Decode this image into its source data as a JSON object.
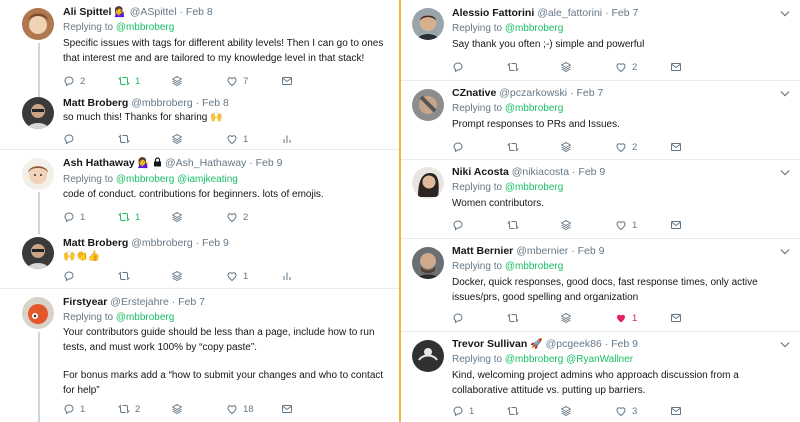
{
  "left": [
    {
      "name": "Ali Spittel",
      "handle": "@ASpittel",
      "time": "Feb 8",
      "emoji": "💁‍♀️",
      "reply_prefix": "Replying to",
      "reply_to": "@mbbroberg",
      "text": "Specific issues with tags for different ability levels! Then I can go to ones that interest me and are tailored to my knowledge level in that stack!",
      "replies": "2",
      "retweets": "1",
      "likes": "7"
    },
    {
      "name": "Matt Broberg",
      "handle": "@mbbroberg",
      "time": "Feb 8",
      "text": "so much this! Thanks for sharing 🙌",
      "likes": "1"
    },
    {
      "name": "Ash Hathaway",
      "handle": "@Ash_Hathaway",
      "time": "Feb 9",
      "emoji": "💁‍♀️",
      "reply_prefix": "Replying to",
      "reply_to": "@mbbroberg",
      "reply_to2": "@iamjkeating",
      "text": "code of conduct. contributions for beginners. lots of emojis.",
      "replies": "1",
      "retweets": "1",
      "likes": "2"
    },
    {
      "name": "Matt Broberg",
      "handle": "@mbbroberg",
      "time": "Feb 9",
      "text": "🙌👏👍",
      "likes": "1"
    },
    {
      "name": "Firstyear",
      "handle": "@Erstejahre",
      "time": "Feb 7",
      "reply_prefix": "Replying to",
      "reply_to": "@mbbroberg",
      "text1": "Your contributors guide should be less than a page, include how to run tests, and must work 100% by “copy paste”.",
      "text2": "For bonus marks add a “how to submit your changes and who to contact for help”",
      "replies": "1",
      "retweets": "2",
      "likes": "18"
    }
  ],
  "right": [
    {
      "name": "Alessio Fattorini",
      "handle": "@ale_fattorini",
      "time": "Feb 7",
      "reply_prefix": "Replying to",
      "reply_to": "@mbbroberg",
      "text": "Say thank you often ;-) simple and powerful",
      "likes": "2"
    },
    {
      "name": "CZnative",
      "handle": "@pczarkowski",
      "time": "Feb 7",
      "reply_prefix": "Replying to",
      "reply_to": "@mbbroberg",
      "text": "Prompt responses to PRs and Issues.",
      "likes": "2"
    },
    {
      "name": "Niki Acosta",
      "handle": "@nikiacosta",
      "time": "Feb 9",
      "reply_prefix": "Replying to",
      "reply_to": "@mbbroberg",
      "text": "Women contributors.",
      "likes": "1"
    },
    {
      "name": "Matt Bernier",
      "handle": "@mbernier",
      "time": "Feb 9",
      "reply_prefix": "Replying to",
      "reply_to": "@mbbroberg",
      "text": "Docker, quick responses, good docs, fast response times, only active issues/prs, good spelling and organization",
      "likes": "1"
    },
    {
      "name": "Trevor Sullivan",
      "handle": "@pcgeek86",
      "time": "Feb 9",
      "emoji": "🚀",
      "reply_prefix": "Replying to",
      "reply_to": "@mbbroberg",
      "reply_to2": "@RyanWallner",
      "text": "Kind, welcoming project admins who approach discussion from a collaborative attitude vs. putting up barriers.",
      "replies": "1",
      "likes": "3"
    }
  ],
  "colors": {
    "accent": "#1da1f2",
    "link": "#17bf63",
    "liked": "#e0245e",
    "divider": "#f5b63f"
  }
}
